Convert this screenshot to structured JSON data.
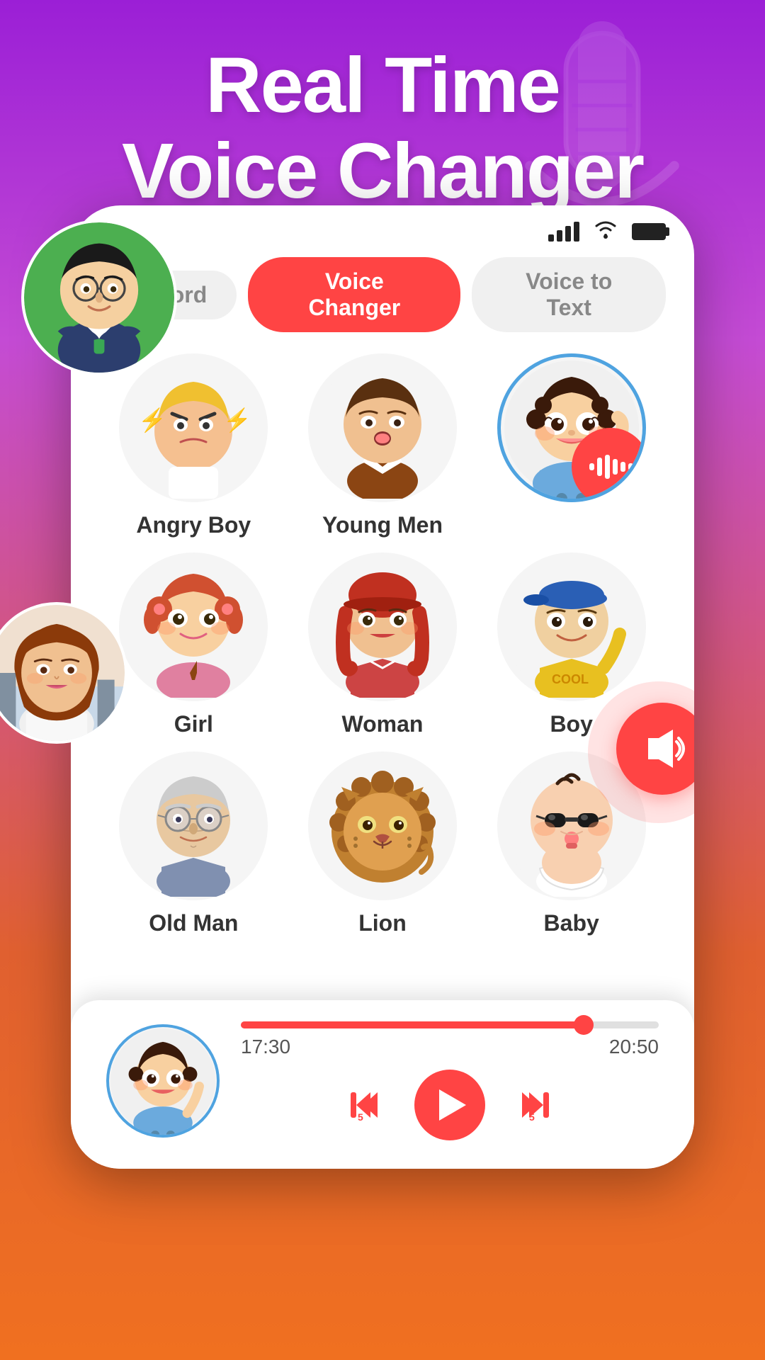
{
  "header": {
    "line1": "Real Time",
    "line2": "Voice Changer"
  },
  "tabs": [
    {
      "id": "record",
      "label": "Record",
      "active": false
    },
    {
      "id": "voice-changer",
      "label": "Voice Changer",
      "active": true
    },
    {
      "id": "voice-to-text",
      "label": "Voice to Text",
      "active": false
    }
  ],
  "voices": [
    {
      "id": "angry-boy",
      "label": "Angry Boy",
      "emoji": "😠",
      "bg": "#f5f5f5",
      "selected": false
    },
    {
      "id": "young-men",
      "label": "Young Men",
      "emoji": "👨",
      "bg": "#f5f5f5",
      "selected": false
    },
    {
      "id": "child",
      "label": "",
      "emoji": "👦",
      "bg": "#f5f5f5",
      "selected": true
    },
    {
      "id": "girl",
      "label": "Girl",
      "emoji": "👧",
      "bg": "#f5f5f5",
      "selected": false
    },
    {
      "id": "woman",
      "label": "Woman",
      "emoji": "👩",
      "bg": "#f5f5f5",
      "selected": false
    },
    {
      "id": "boy",
      "label": "Boy",
      "emoji": "🧒",
      "bg": "#f5f5f5",
      "selected": false
    },
    {
      "id": "old-man",
      "label": "Old Man",
      "emoji": "👴",
      "bg": "#f5f5f5",
      "selected": false
    },
    {
      "id": "lion",
      "label": "Lion",
      "emoji": "🦁",
      "bg": "#f5f5f5",
      "selected": false
    },
    {
      "id": "baby",
      "label": "Baby",
      "emoji": "👶",
      "bg": "#f5f5f5",
      "selected": false
    }
  ],
  "player": {
    "current_time": "17:30",
    "total_time": "20:50",
    "progress": 82
  },
  "status_bar": {
    "signal": "4 bars",
    "wifi": "on",
    "battery": "full"
  }
}
